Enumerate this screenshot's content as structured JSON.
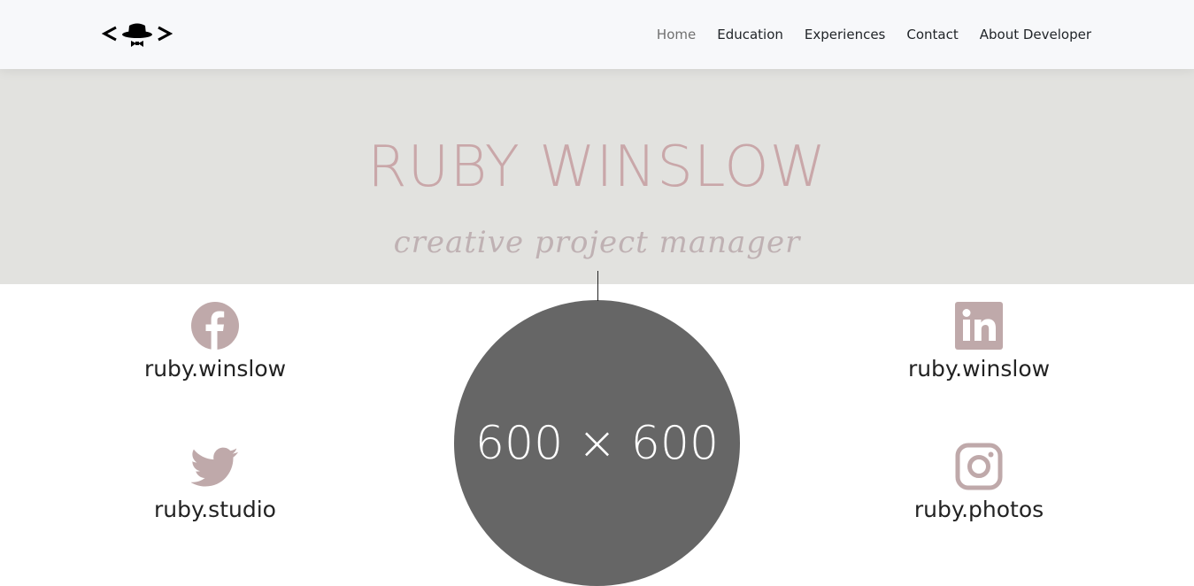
{
  "navbar": {
    "logo_icon": "hat-bowtie-code-logo",
    "links": [
      {
        "label": "Home",
        "active": true
      },
      {
        "label": "Education"
      },
      {
        "label": "Experiences"
      },
      {
        "label": "Contact"
      },
      {
        "label": "About Developer"
      }
    ]
  },
  "hero": {
    "name": "RUBY WINSLOW",
    "subtitle": "creative project manager"
  },
  "profile": {
    "placeholder_text": "600 × 600"
  },
  "social": {
    "facebook": {
      "icon": "facebook-icon",
      "handle": "ruby.winslow"
    },
    "linkedin": {
      "icon": "linkedin-icon",
      "handle": "ruby.winslow"
    },
    "twitter": {
      "icon": "twitter-icon",
      "handle": "ruby.studio"
    },
    "instagram": {
      "icon": "instagram-icon",
      "handle": "ruby.photos"
    }
  },
  "colors": {
    "accent": "#c9a7a9",
    "icon": "#bfa9aa",
    "hero_bg": "#e2e2df",
    "nav_bg": "#f7f8fa",
    "placeholder_bg": "#666666"
  }
}
